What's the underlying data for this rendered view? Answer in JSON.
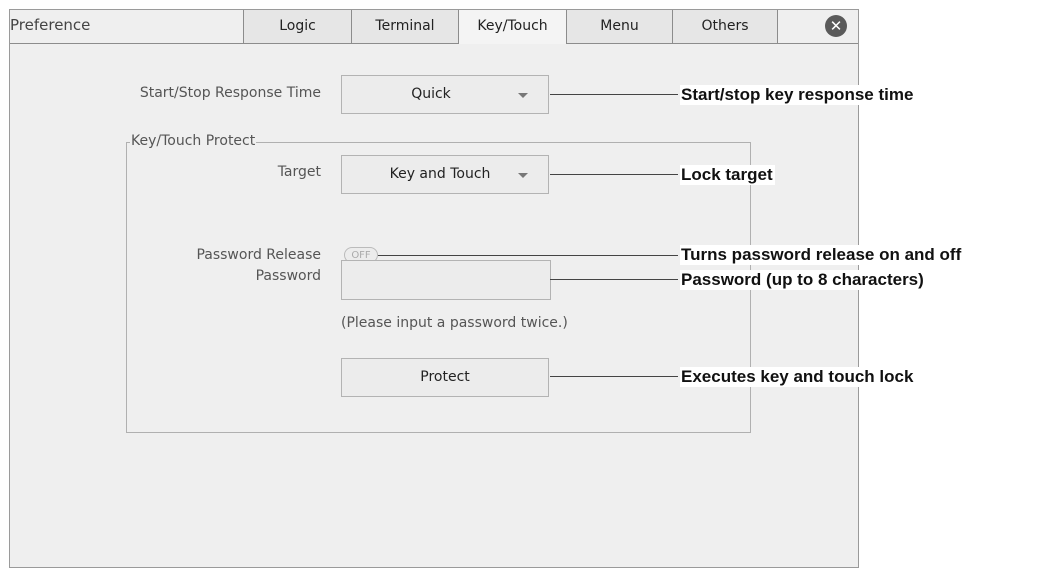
{
  "window": {
    "title": "Preference"
  },
  "tabs": [
    {
      "label": "Logic",
      "active": false
    },
    {
      "label": "Terminal",
      "active": false
    },
    {
      "label": "Key/Touch",
      "active": true
    },
    {
      "label": "Menu",
      "active": false
    },
    {
      "label": "Others",
      "active": false
    }
  ],
  "close_icon": "✕",
  "settings": {
    "response_time_label": "Start/Stop Response Time",
    "response_time_value": "Quick",
    "group_title": "Key/Touch Protect",
    "target_label": "Target",
    "target_value": "Key and Touch",
    "password_release_label": "Password Release",
    "password_release_state": "OFF",
    "password_label": "Password",
    "password_value": "",
    "password_hint": "(Please input a password twice.)",
    "protect_button": "Protect"
  },
  "callouts": {
    "response_time": "Start/stop key response time",
    "target": "Lock target",
    "password_release": "Turns password release on and off",
    "password": "Password (up to 8 characters)",
    "protect": "Executes key and touch lock"
  },
  "colors": {
    "panel_bg": "#efefef",
    "callout_text": "#111111"
  }
}
